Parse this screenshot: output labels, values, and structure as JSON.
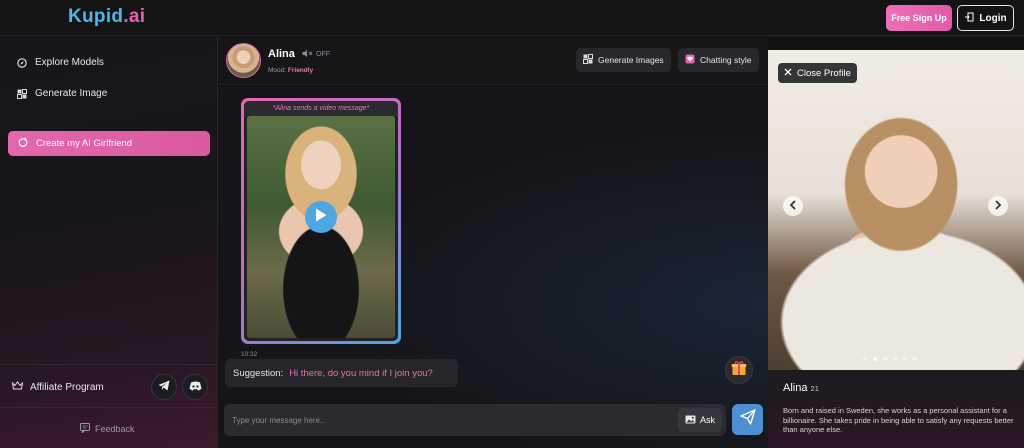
{
  "header": {
    "logo": {
      "k": "K",
      "rest": "upid",
      "dot": ".",
      "ai": "ai"
    },
    "signup_label": "Free Sign Up",
    "login_label": "Login"
  },
  "sidebar": {
    "items": [
      {
        "label": "Explore Models",
        "icon": "compass-icon"
      },
      {
        "label": "Generate Image",
        "icon": "image-icon"
      }
    ],
    "create_label": "Create my AI Girlfriend",
    "affiliate_label": "Affiliate Program",
    "feedback_label": "Feedback"
  },
  "chat": {
    "name": "Alina",
    "sound_state": "OFF",
    "mood_label": "Mood:",
    "mood_value": "Friendly",
    "generate_images_label": "Generate Images",
    "chatting_style_label": "Chatting style",
    "video_caption": "*Alina sends a video message*",
    "message_time": "10:32",
    "suggestion_label": "Suggestion:",
    "suggestion_text": "Hi there, do you mind if I join you?",
    "input_placeholder": "Type your message here..",
    "ask_label": "Ask"
  },
  "profile": {
    "close_label": "Close Profile",
    "name": "Alina",
    "age": "21",
    "bio": "Born and raised in Sweden, she works as a personal assistant for a billionaire. She takes pride in being able to satisfy any requests better than anyone else.",
    "carousel_count": 6,
    "carousel_active": 1
  },
  "colors": {
    "accent_pink": "#e466ad",
    "accent_blue": "#4fa6e0",
    "background": "#131316"
  }
}
